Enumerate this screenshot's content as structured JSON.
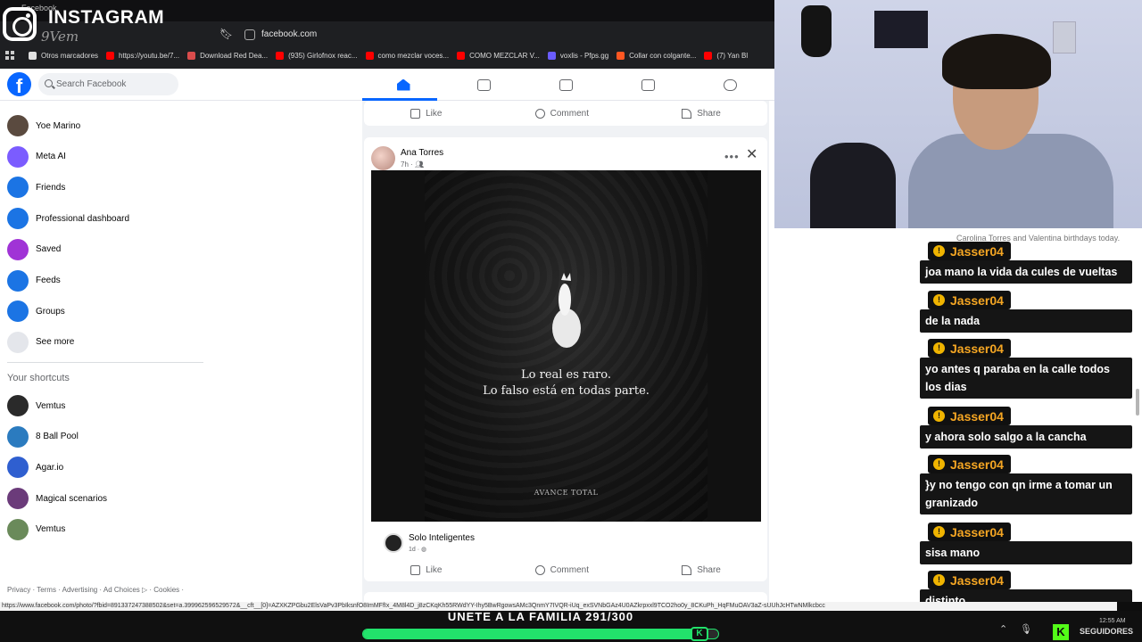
{
  "colors": {
    "fb_blue": "#0866ff",
    "chat_username": "#f5a623",
    "kick_green": "#53fc18",
    "goal_green": "#22e26b"
  },
  "browser": {
    "tab_title": "Facebook",
    "url": "facebook.com",
    "bookmarks": [
      {
        "label": "Otros marcadores",
        "icon": "folder-icon",
        "color": "#e0e0e0"
      },
      {
        "label": "https://youtu.be/7...",
        "icon": "youtube-icon",
        "color": "#ff0000"
      },
      {
        "label": "Download Red Dea...",
        "icon": "download-icon",
        "color": "#d94c4c"
      },
      {
        "label": "(935) Girlofnox reac...",
        "icon": "youtube-icon",
        "color": "#ff0000"
      },
      {
        "label": "como mezclar voces...",
        "icon": "youtube-icon",
        "color": "#ff0000"
      },
      {
        "label": "COMO MEZCLAR V...",
        "icon": "youtube-icon",
        "color": "#ff0000"
      },
      {
        "label": "voxlis - Pfps.gg",
        "icon": "pfps-icon",
        "color": "#6a5cff"
      },
      {
        "label": "Collar con colgante...",
        "icon": "shop-icon",
        "color": "#ff5722"
      },
      {
        "label": "(7) Yan Bl",
        "icon": "youtube-icon",
        "color": "#ff0000"
      }
    ]
  },
  "watermark": {
    "brand": "INSTAGRAM",
    "handle": "9Vem"
  },
  "facebook": {
    "search_placeholder": "Search Facebook",
    "sidebar": [
      {
        "label": "Yoe Marino",
        "icon": "profile-avatar",
        "color": "#5a4a3f"
      },
      {
        "label": "Meta AI",
        "icon": "meta-ai-icon",
        "color": "#7b5cff"
      },
      {
        "label": "Friends",
        "icon": "friends-icon",
        "color": "#1b74e4"
      },
      {
        "label": "Professional dashboard",
        "icon": "dashboard-icon",
        "color": "#1b74e4"
      },
      {
        "label": "Saved",
        "icon": "saved-icon",
        "color": "#a033d6"
      },
      {
        "label": "Feeds",
        "icon": "feeds-icon",
        "color": "#1b74e4"
      },
      {
        "label": "Groups",
        "icon": "groups-icon",
        "color": "#1b74e4"
      },
      {
        "label": "See more",
        "icon": "chevron-down-icon",
        "color": "#e4e6eb"
      }
    ],
    "shortcuts_heading": "Your shortcuts",
    "shortcuts": [
      {
        "label": "Vemtus",
        "icon": "vemtus-avatar",
        "color": "#2a2a2a"
      },
      {
        "label": "8 Ball Pool",
        "icon": "8-ball-pool-avatar",
        "color": "#2b7bbf"
      },
      {
        "label": "Agar.io",
        "icon": "agar-io-avatar",
        "color": "#2f5fd0"
      },
      {
        "label": "Magical scenarios",
        "icon": "magical-scenarios-avatar",
        "color": "#6b3b7a"
      },
      {
        "label": "Vemtus",
        "icon": "vemtus-avatar",
        "color": "#6a8a5a"
      }
    ],
    "footer": "Privacy · Terms · Advertising · Ad Choices ▷ · Cookies ·",
    "actions": {
      "like": "Like",
      "comment": "Comment",
      "share": "Share"
    },
    "post": {
      "author": "Ana Torres",
      "time": "7h · ",
      "quote_line1": "Lo real es raro.",
      "quote_line2": "Lo falso está en todas parte.",
      "image_brand": "AVANCE TOTAL",
      "shared_page": "Solo Inteligentes",
      "shared_time": "1d · "
    }
  },
  "chat": {
    "ghost_text": "Carolina Torres and Valentina birthdays today.",
    "messages": [
      {
        "user": "Jasser04",
        "text": "joa mano la vida da cules de vueltas"
      },
      {
        "user": "Jasser04",
        "text": "de la nada"
      },
      {
        "user": "Jasser04",
        "text": "yo antes q paraba en la calle todos los dias"
      },
      {
        "user": "Jasser04",
        "text": "y ahora solo salgo a la cancha"
      },
      {
        "user": "Jasser04",
        "text": "}y no tengo con qn irme a tomar un granizado"
      },
      {
        "user": "Jasser04",
        "text": "sisa mano"
      },
      {
        "user": "Jasser04",
        "text": "distinto"
      }
    ]
  },
  "status_url": "https://www.facebook.com/photo/?fbid=891337247388502&set=a.399962596529572&__cft__[0]=AZXKZPGbu2ElsVaPv3PbIksnfO8ImMFfIx_4M8l4D_j8zCKqKh55RWdYY-Ihy5BwRgowsAMc3QnmY7IVQR-iUq_exSVNbGAz4U0AZkrpxxl9TCO2ho0y_8CKuPh_HqFMuOAV3aZ-sUUhJcHTwNMlkcbcc",
  "goal": {
    "text": "UNETE A LA FAMILIA 291/300",
    "progress": 0.97
  },
  "stream": {
    "follow": "SEGUIDORES",
    "kick_letter": "K",
    "clock": "12:55 AM"
  }
}
